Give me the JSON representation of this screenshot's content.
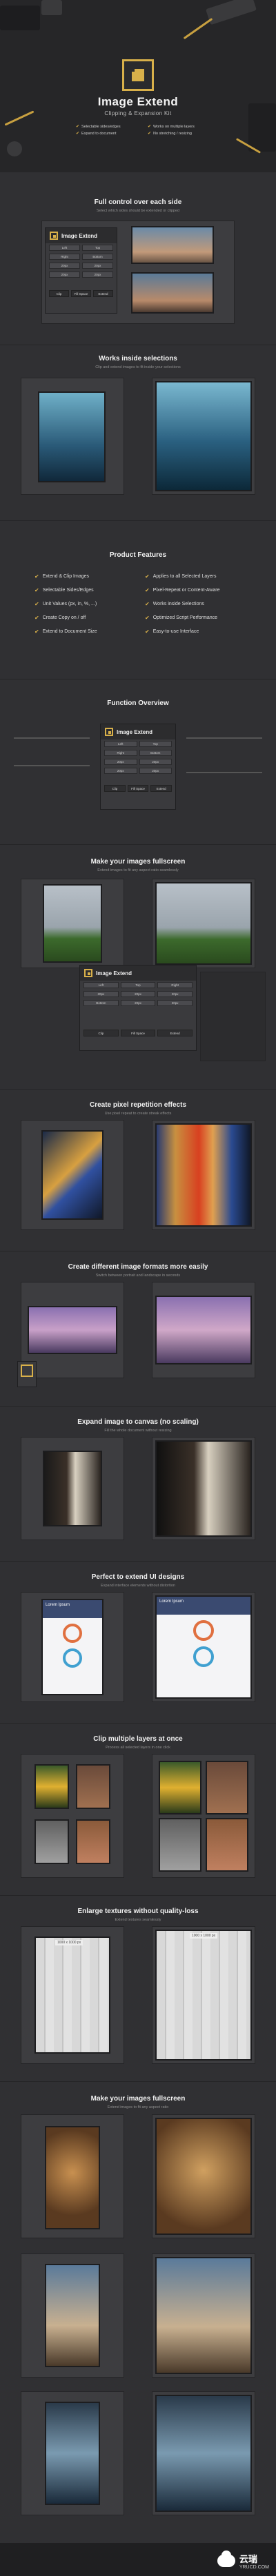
{
  "hero": {
    "title": "Image Extend",
    "subtitle": "Clipping & Expansion Kit",
    "features": [
      "Selectable sides/edges",
      "Works on multiple layers",
      "Expand to document",
      "No stretching / resizing"
    ]
  },
  "panel": {
    "title": "Image Extend",
    "cells": [
      "Left",
      "Top",
      "Right",
      "Bottom",
      "20px",
      "20px",
      "20px",
      "20px"
    ],
    "buttons": [
      "Clip",
      "Fill Space",
      "Extend"
    ]
  },
  "sections": [
    {
      "title": "Full control over each side",
      "sub": "Select which sides should be extended or clipped"
    },
    {
      "title": "Works inside selections",
      "sub": "Clip and extend images to fit inside your selections"
    },
    {
      "title": "Product Features",
      "sub": ""
    },
    {
      "title": "Function Overview",
      "sub": ""
    },
    {
      "title": "Make your images fullscreen",
      "sub": "Extend images to fit any aspect ratio seamlessly"
    },
    {
      "title": "Create pixel repetition effects",
      "sub": "Use pixel repeat to create streak effects"
    },
    {
      "title": "Create different image formats more easily",
      "sub": "Switch between portrait and landscape in seconds"
    },
    {
      "title": "Expand image to canvas (no scaling)",
      "sub": "Fill the whole document without resizing"
    },
    {
      "title": "Perfect to extend UI designs",
      "sub": "Expand interface elements without distortion"
    },
    {
      "title": "Clip multiple layers at once",
      "sub": "Process all selected layers in one click"
    },
    {
      "title": "Enlarge textures without quality-loss",
      "sub": "Extend textures seamlessly"
    },
    {
      "title": "Make your images fullscreen",
      "sub": "Extend images to fit any aspect ratio"
    }
  ],
  "features": [
    "Extend & Clip Images",
    "Applies to all Selected Layers",
    "Selectable Sides/Edges",
    "Pixel-Repeat or Content-Aware",
    "Unit Values (px, in, %, ...)",
    "Works inside Selections",
    "Create Copy on / off",
    "Optimized Script Performance",
    "Extend to Document Size",
    "Easy-to-use Interface"
  ],
  "ui_card": {
    "title": "Lorem Ipsum"
  },
  "texture_label": "1000 x 1000 px",
  "watermark": {
    "brand": "云瑞",
    "url": "YRUCD.COM"
  },
  "colors": {
    "accent": "#d8b04a",
    "bg": "#303033"
  }
}
